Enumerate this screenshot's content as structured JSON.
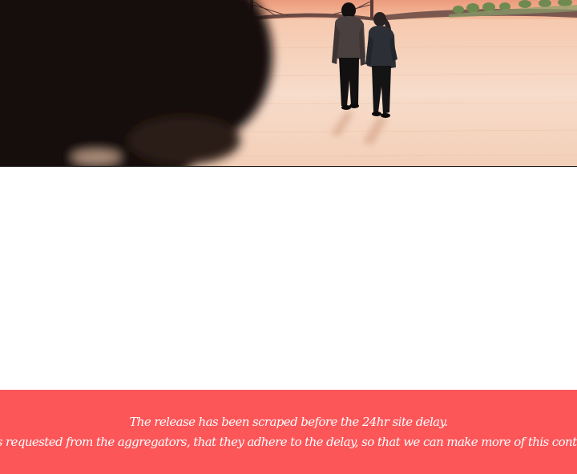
{
  "panel": {
    "image": "two-figures-walking-on-frozen-river-at-sunset",
    "colors": {
      "sky": "#f2b48f",
      "ground": "#f4d3bf",
      "shadow": "#1a0f0c"
    }
  },
  "notice": {
    "line1": "The release has been scraped before the 24hr site delay.",
    "line2": "it is requested from the aggregators, that they adhere to the delay, so that we can make more of this content",
    "background": "#fc5659",
    "text_color": "#ffffff"
  }
}
